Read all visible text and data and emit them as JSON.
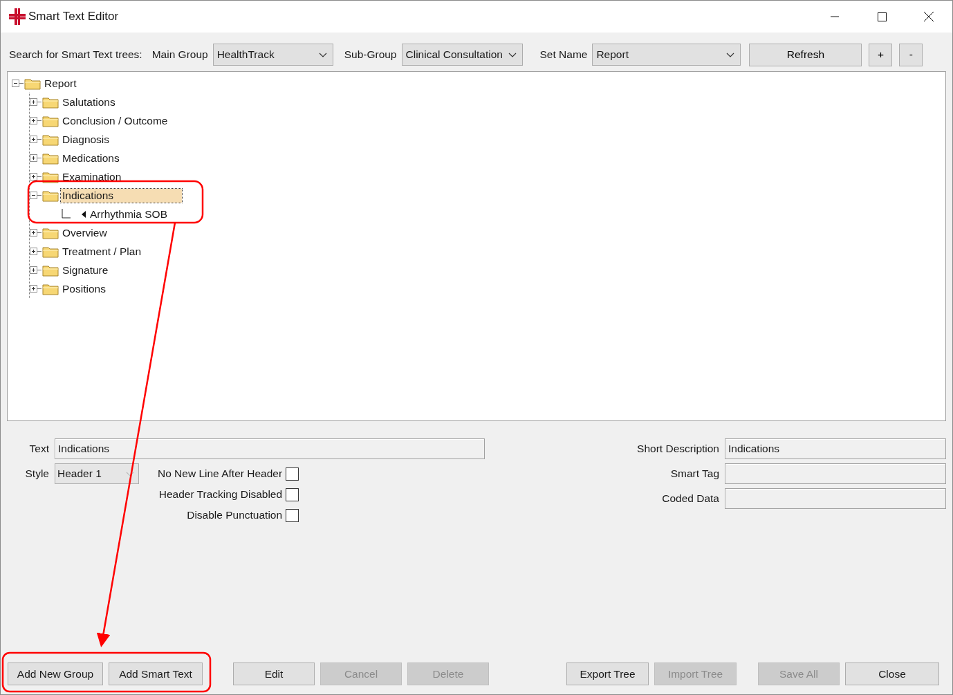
{
  "window": {
    "title": "Smart Text Editor"
  },
  "search_bar": {
    "label": "Search for Smart Text trees:",
    "filters": [
      {
        "label": "Main Group",
        "value": "HealthTrack"
      },
      {
        "label": "Sub-Group",
        "value": "Clinical Consultation"
      },
      {
        "label": "Set Name",
        "value": "Report"
      }
    ],
    "buttons": [
      "Refresh",
      "+",
      "-"
    ]
  },
  "tree": {
    "items": [
      {
        "label": "Report",
        "kind": "folder",
        "expanded": true,
        "selected": false,
        "children": [
          {
            "label": "Salutations",
            "kind": "folder",
            "expanded": false,
            "selected": false
          },
          {
            "label": "Conclusion / Outcome",
            "kind": "folder",
            "expanded": false,
            "selected": false
          },
          {
            "label": "Diagnosis",
            "kind": "folder",
            "expanded": false,
            "selected": false
          },
          {
            "label": "Medications",
            "kind": "folder",
            "expanded": false,
            "selected": false
          },
          {
            "label": "Examination",
            "kind": "folder",
            "expanded": false,
            "selected": false
          },
          {
            "label": "Indications",
            "kind": "folder",
            "expanded": true,
            "selected": true,
            "children": [
              {
                "label": "Arrhythmia SOB",
                "kind": "text",
                "selected": false
              }
            ]
          },
          {
            "label": "Overview",
            "kind": "folder",
            "expanded": false,
            "selected": false
          },
          {
            "label": "Treatment / Plan",
            "kind": "folder",
            "expanded": false,
            "selected": false
          },
          {
            "label": "Signature",
            "kind": "folder",
            "expanded": false,
            "selected": false
          },
          {
            "label": "Positions",
            "kind": "folder",
            "expanded": false,
            "selected": false
          }
        ]
      }
    ]
  },
  "details": {
    "text": {
      "label": "Text",
      "value": "Indications"
    },
    "style": {
      "label": "Style",
      "value": "Header 1"
    },
    "checkboxes": [
      {
        "label": "No New Line After Header",
        "checked": false
      },
      {
        "label": "Header Tracking Disabled",
        "checked": false
      },
      {
        "label": "Disable Punctuation",
        "checked": false
      }
    ],
    "right_fields": [
      {
        "label": "Short Description",
        "value": "Indications"
      },
      {
        "label": "Smart Tag"
      },
      {
        "label": "Coded Data"
      }
    ]
  },
  "button_groups": [
    [
      {
        "label": "Add New Group",
        "disabled": false
      },
      {
        "label": "Add Smart Text",
        "disabled": false
      }
    ],
    [
      {
        "label": "Edit",
        "disabled": false
      },
      {
        "label": "Cancel",
        "disabled": true
      },
      {
        "label": "Delete",
        "disabled": true
      }
    ],
    [
      {
        "label": "Export Tree",
        "disabled": false
      },
      {
        "label": "Import Tree",
        "disabled": true
      }
    ],
    [
      {
        "label": "Save All",
        "disabled": true
      },
      {
        "label": "Close",
        "disabled": false
      }
    ]
  ]
}
